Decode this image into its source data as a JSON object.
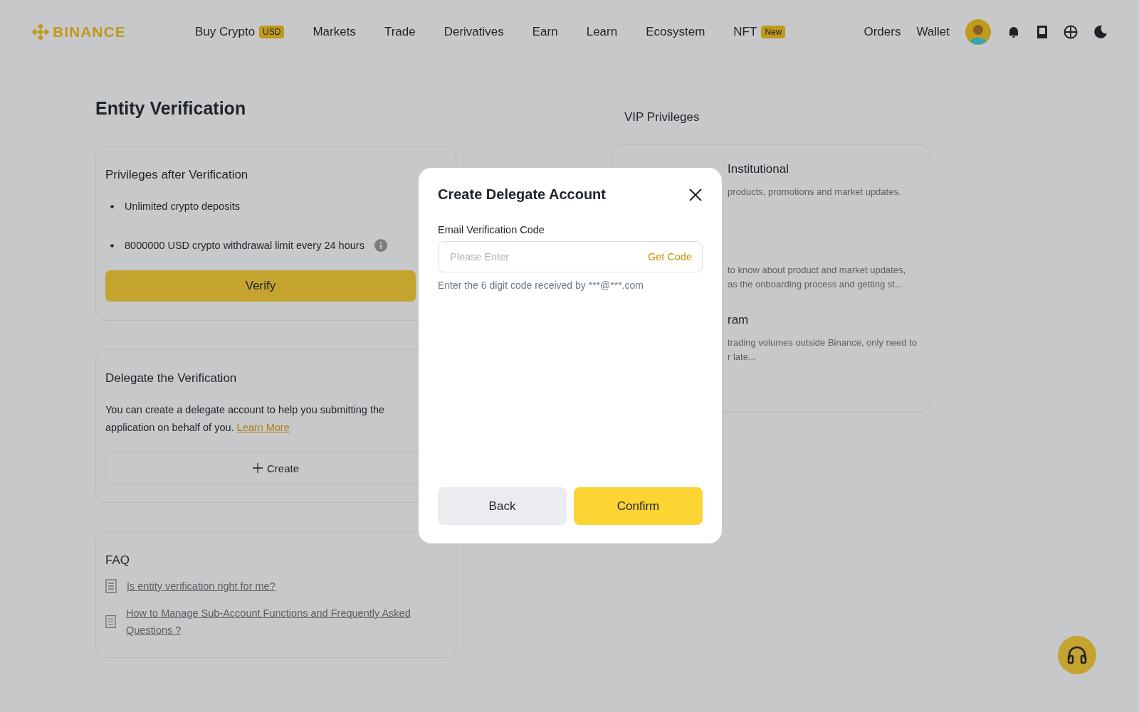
{
  "nav": {
    "logo": "BINANCE",
    "items": [
      {
        "label": "Buy Crypto",
        "badge": "USD"
      },
      {
        "label": "Markets"
      },
      {
        "label": "Trade"
      },
      {
        "label": "Derivatives"
      },
      {
        "label": "Earn"
      },
      {
        "label": "Learn"
      },
      {
        "label": "Ecosystem"
      },
      {
        "label": "NFT",
        "badge": "New"
      }
    ],
    "right": [
      "Orders",
      "Wallet"
    ]
  },
  "page_title": "Entity Verification",
  "privileges": {
    "title": "Privileges after Verification",
    "items": [
      {
        "text": "Unlimited crypto deposits",
        "info": false
      },
      {
        "text": "8000000 USD crypto withdrawal limit every 24 hours",
        "info": true
      }
    ],
    "button": "Verify"
  },
  "delegate": {
    "title": "Delegate the Verification",
    "text": "You can create a delegate account to help you submitting the application on behalf of you.",
    "link": "Learn More",
    "button": "Create"
  },
  "faq": {
    "title": "FAQ",
    "items": [
      "Is entity verification right for me?",
      "How to Manage Sub-Account Functions and Frequently Asked Questions ? "
    ]
  },
  "vip": {
    "title": "VIP Privileges",
    "sections": [
      {
        "heading": "Institutional",
        "lines": [
          "products, promotions and market updates."
        ]
      },
      {
        "lines": [
          "to know about product and market updates,",
          "as the onboarding process and getting st..."
        ]
      },
      {
        "heading": "ram",
        "lines": [
          "trading volumes outside Binance, only need to",
          "r late..."
        ]
      }
    ]
  },
  "modal": {
    "title": "Create Delegate Account",
    "field_label": "Email Verification Code",
    "placeholder": "Please Enter",
    "get_code": "Get Code",
    "hint": "Enter the 6 digit code received by ***@***.com",
    "back": "Back",
    "confirm": "Confirm"
  }
}
